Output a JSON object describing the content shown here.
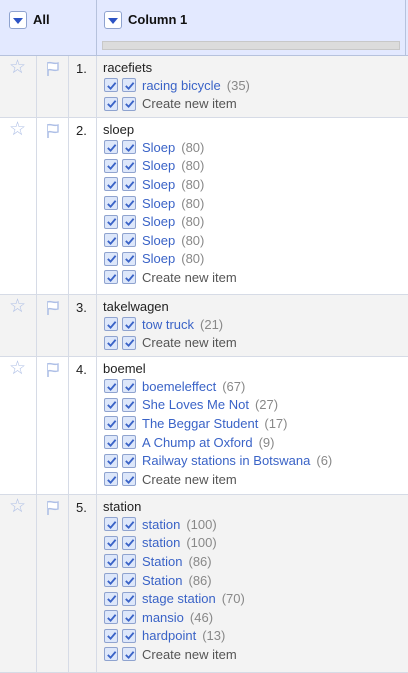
{
  "header": {
    "all_label": "All",
    "column_label": "Column 1"
  },
  "rows": [
    {
      "index": "1.",
      "name": "racefiets",
      "candidates": [
        {
          "text": "racing bicycle",
          "score": "(35)"
        }
      ],
      "create_label": "Create new item"
    },
    {
      "index": "2.",
      "name": "sloep",
      "candidates": [
        {
          "text": "Sloep",
          "score": "(80)"
        },
        {
          "text": "Sloep",
          "score": "(80)"
        },
        {
          "text": "Sloep",
          "score": "(80)"
        },
        {
          "text": "Sloep",
          "score": "(80)"
        },
        {
          "text": "Sloep",
          "score": "(80)"
        },
        {
          "text": "Sloep",
          "score": "(80)"
        },
        {
          "text": "Sloep",
          "score": "(80)"
        }
      ],
      "create_label": "Create new item"
    },
    {
      "index": "3.",
      "name": "takelwagen",
      "candidates": [
        {
          "text": "tow truck",
          "score": "(21)"
        }
      ],
      "create_label": "Create new item"
    },
    {
      "index": "4.",
      "name": "boemel",
      "candidates": [
        {
          "text": "boemeleffect",
          "score": "(67)"
        },
        {
          "text": "She Loves Me Not",
          "score": "(27)"
        },
        {
          "text": "The Beggar Student",
          "score": "(17)"
        },
        {
          "text": "A Chump at Oxford",
          "score": "(9)"
        },
        {
          "text": "Railway stations in Botswana",
          "score": "(6)"
        }
      ],
      "create_label": "Create new item"
    },
    {
      "index": "5.",
      "name": "station",
      "candidates": [
        {
          "text": "station",
          "score": "(100)"
        },
        {
          "text": "station",
          "score": "(100)"
        },
        {
          "text": "Station",
          "score": "(86)"
        },
        {
          "text": "Station",
          "score": "(86)"
        },
        {
          "text": "stage station",
          "score": "(70)"
        },
        {
          "text": "mansio",
          "score": "(46)"
        },
        {
          "text": "hardpoint",
          "score": "(13)"
        }
      ],
      "create_label": "Create new item"
    }
  ]
}
